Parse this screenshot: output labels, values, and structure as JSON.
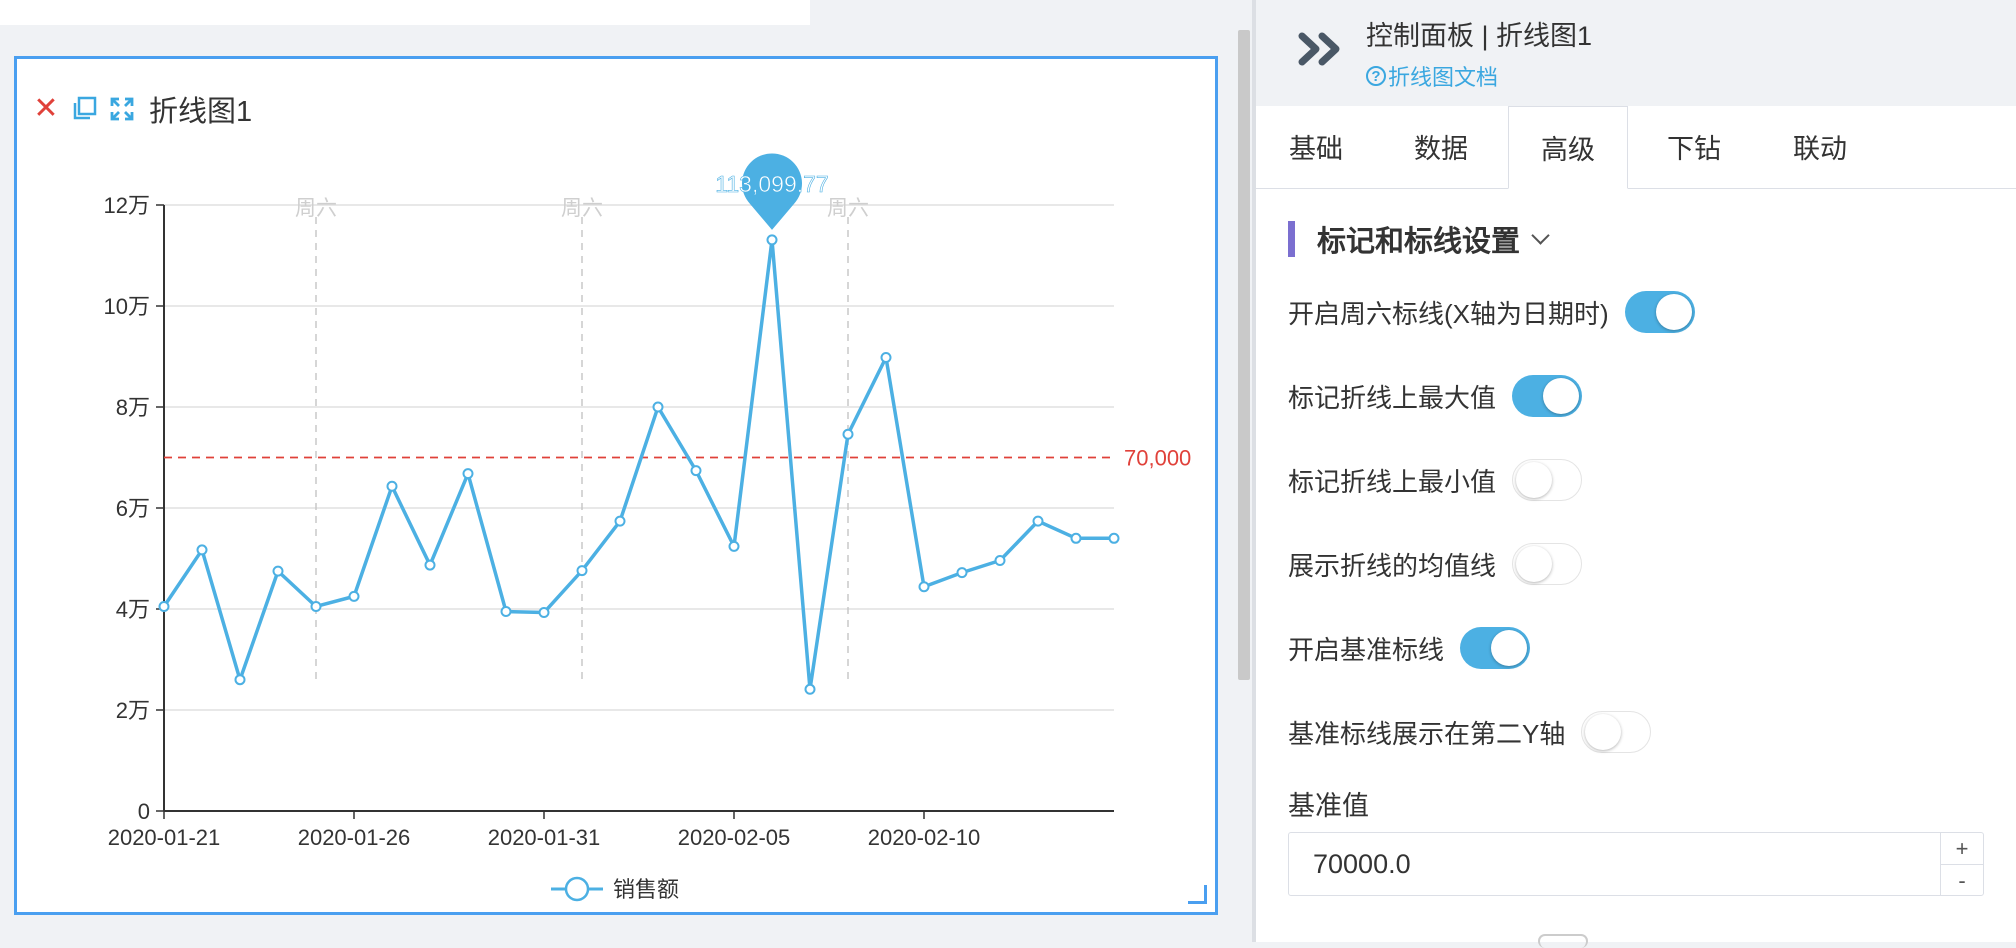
{
  "chart_card": {
    "title": "折线图1",
    "icons": [
      "close-icon",
      "copy-icon",
      "fullscreen-icon"
    ]
  },
  "chart_data": {
    "type": "line",
    "title": "",
    "xlabel": "",
    "ylabel": "",
    "x": [
      "2020-01-21",
      "2020-01-22",
      "2020-01-23",
      "2020-01-24",
      "2020-01-25",
      "2020-01-26",
      "2020-01-27",
      "2020-01-28",
      "2020-01-29",
      "2020-01-30",
      "2020-01-31",
      "2020-02-01",
      "2020-02-02",
      "2020-02-03",
      "2020-02-04",
      "2020-02-05",
      "2020-02-06",
      "2020-02-07",
      "2020-02-08",
      "2020-02-09",
      "2020-02-10",
      "2020-02-11",
      "2020-02-12",
      "2020-02-13",
      "2020-02-14",
      "2020-02-15"
    ],
    "x_tick_labels": [
      "2020-01-21",
      "2020-01-26",
      "2020-01-31",
      "2020-02-05",
      "2020-02-10"
    ],
    "series": [
      {
        "name": "销售额",
        "color": "#4cb0e3",
        "values": [
          40500,
          51700,
          26000,
          47500,
          40500,
          42500,
          64300,
          48700,
          66800,
          39500,
          39300,
          47600,
          57400,
          80000,
          67400,
          52400,
          113099.77,
          24100,
          74600,
          89800,
          44400,
          47200,
          49600,
          57400,
          54000,
          54000
        ]
      }
    ],
    "y_ticks": [
      "0",
      "2万",
      "4万",
      "6万",
      "8万",
      "10万",
      "12万"
    ],
    "ylim": [
      0,
      120000
    ],
    "grid": true,
    "legend": "bottom-center",
    "max_marker": {
      "label": "113,099.77",
      "value": 113099.77,
      "x": "2020-02-06"
    },
    "baseline": {
      "value": 70000,
      "label": "70,000",
      "color": "#e0413a"
    },
    "saturday_lines": [
      {
        "x": "2020-01-25",
        "label": "周六"
      },
      {
        "x": "2020-02-01",
        "label": "周六"
      },
      {
        "x": "2020-02-08",
        "label": "周六"
      }
    ]
  },
  "panel": {
    "title": "控制面板 | 折线图1",
    "doc_link": "折线图文档",
    "tabs": [
      {
        "label": "基础",
        "active": false
      },
      {
        "label": "数据",
        "active": false
      },
      {
        "label": "高级",
        "active": true
      },
      {
        "label": "下钻",
        "active": false
      },
      {
        "label": "联动",
        "active": false
      }
    ],
    "section_title": "标记和标线设置",
    "toggles": [
      {
        "label": "开启周六标线(X轴为日期时)",
        "on": true
      },
      {
        "label": "标记折线上最大值",
        "on": true
      },
      {
        "label": "标记折线上最小值",
        "on": false
      },
      {
        "label": "展示折线的均值线",
        "on": false
      },
      {
        "label": "开启基准标线",
        "on": true
      },
      {
        "label": "基准标线展示在第二Y轴",
        "on": false
      }
    ],
    "baseline_field": {
      "label": "基准值",
      "value": "70000.0",
      "plus": "+",
      "minus": "-"
    }
  }
}
